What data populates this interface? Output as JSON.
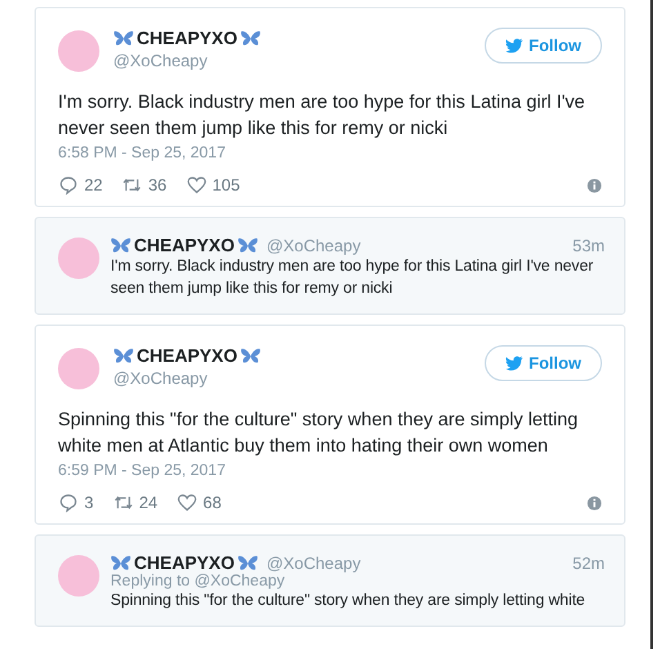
{
  "tweets": [
    {
      "kind": "embed",
      "name": "CHEAPYXO",
      "handle": "@XoCheapy",
      "follow": "Follow",
      "text": "I'm sorry. Black industry men are too hype for this Latina girl I've never seen them jump like this for remy or nicki",
      "timestamp": "6:58 PM - Sep 25, 2017",
      "replies": "22",
      "retweets": "36",
      "likes": "105"
    },
    {
      "kind": "compact",
      "name": "CHEAPYXO",
      "handle": "@XoCheapy",
      "time": "53m",
      "text": "I'm sorry. Black industry men are too hype for this Latina girl I've never seen them jump like this for remy or nicki"
    },
    {
      "kind": "embed",
      "name": "CHEAPYXO",
      "handle": "@XoCheapy",
      "follow": "Follow",
      "text": "Spinning this \"for the culture\" story when they are simply letting white men at Atlantic buy them into hating their own women",
      "timestamp": "6:59 PM - Sep 25, 2017",
      "replies": "3",
      "retweets": "24",
      "likes": "68"
    },
    {
      "kind": "compact",
      "name": "CHEAPYXO",
      "handle": "@XoCheapy",
      "time": "52m",
      "replying": "Replying to @XoCheapy",
      "text": "Spinning this \"for the culture\" story when they are simply letting white"
    }
  ]
}
